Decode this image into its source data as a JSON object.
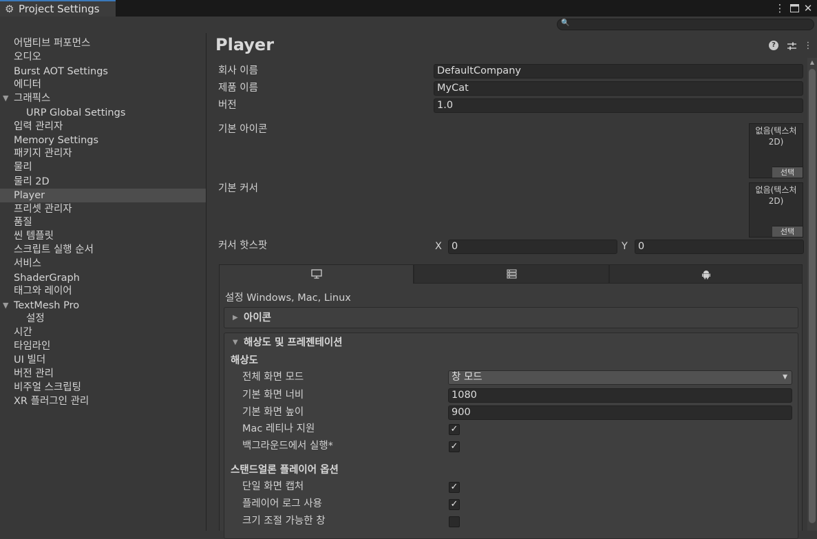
{
  "window": {
    "tab_title": "Project Settings",
    "tab_icon": "gear-icon",
    "controls": [
      "kebab-menu-icon",
      "maximize-icon",
      "close-icon"
    ]
  },
  "search": {
    "placeholder": "",
    "icon": "search-icon"
  },
  "sidebar": {
    "items": [
      {
        "label": "어댑티브 퍼포먼스"
      },
      {
        "label": "오디오"
      },
      {
        "label": "Burst AOT Settings"
      },
      {
        "label": "에디터"
      },
      {
        "label": "그래픽스"
      },
      {
        "label": "URP Global Settings"
      },
      {
        "label": "입력 관리자"
      },
      {
        "label": "Memory Settings"
      },
      {
        "label": "패키지 관리자"
      },
      {
        "label": "물리"
      },
      {
        "label": "물리 2D"
      },
      {
        "label": "Player"
      },
      {
        "label": "프리셋 관리자"
      },
      {
        "label": "품질"
      },
      {
        "label": "씬 템플릿"
      },
      {
        "label": "스크립트 실행 순서"
      },
      {
        "label": "서비스"
      },
      {
        "label": "ShaderGraph"
      },
      {
        "label": "태그와 레이어"
      },
      {
        "label": "TextMesh Pro"
      },
      {
        "label": "설정"
      },
      {
        "label": "시간"
      },
      {
        "label": "타임라인"
      },
      {
        "label": "UI 빌더"
      },
      {
        "label": "버전 관리"
      },
      {
        "label": "비주얼 스크립팅"
      },
      {
        "label": "XR 플러그인 관리"
      }
    ],
    "selected": "Player",
    "accent_color": "#3a79bb"
  },
  "main": {
    "title": "Player",
    "header_icons": [
      "help-icon",
      "preset-icon",
      "kebab-menu-icon"
    ],
    "company_name_label": "회사 이름",
    "company_name_value": "DefaultCompany",
    "product_name_label": "제품 이름",
    "product_name_value": "MyCat",
    "version_label": "버전",
    "version_value": "1.0",
    "default_icon_label": "기본 아이콘",
    "default_icon_slot_text": "없음(텍스처 2D)",
    "default_icon_select": "선택",
    "default_cursor_label": "기본 커서",
    "default_cursor_slot_text": "없음(텍스처 2D)",
    "default_cursor_select": "선택",
    "cursor_hotspot_label": "커서 핫스팟",
    "hotspot_x_label": "X",
    "hotspot_x_value": "0",
    "hotspot_y_label": "Y",
    "hotspot_y_value": "0",
    "platform_tabs": [
      "monitor-icon",
      "server-icon",
      "android-icon"
    ],
    "platform_settings_label": "설정 Windows, Mac, Linux",
    "icon_section_title": "아이콘",
    "resolution_section_title": "해상도 및 프레젠테이션",
    "resolution_subheader": "해상도",
    "fullscreen_mode_label": "전체 화면 모드",
    "fullscreen_mode_value": "창 모드",
    "default_width_label": "기본 화면 너비",
    "default_width_value": "1080",
    "default_height_label": "기본 화면 높이",
    "default_height_value": "900",
    "mac_retina_label": "Mac 레티나 지원",
    "mac_retina_checked": true,
    "run_in_background_label": "백그라운드에서 실행*",
    "run_in_background_checked": true,
    "standalone_subheader": "스탠드얼론 플레이어 옵션",
    "single_capture_label": "단일 화면 캡처",
    "single_capture_checked": true,
    "player_log_label": "플레이어 로그 사용",
    "player_log_checked": true,
    "resizable_window_label": "크기 조절 가능한 창",
    "resizable_window_checked": false
  }
}
